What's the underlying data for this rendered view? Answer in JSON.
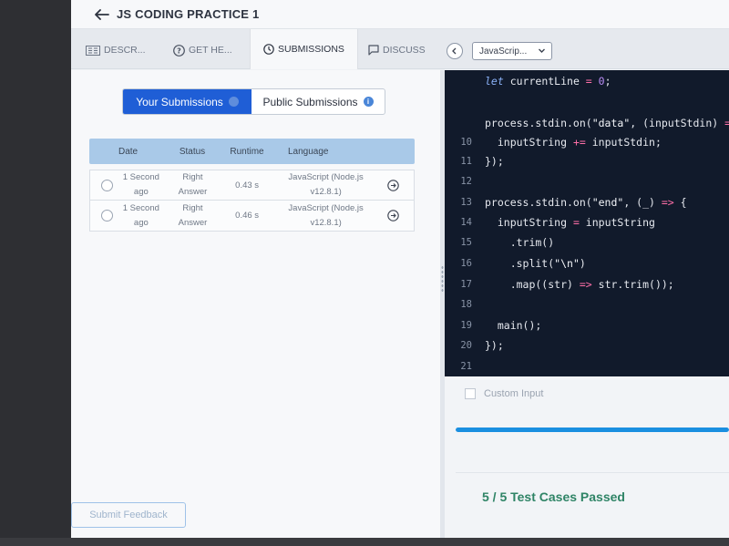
{
  "app": {
    "title": "JS CODING PRACTICE 1"
  },
  "tabs": [
    {
      "label": "DESCR...",
      "icon": "description-icon"
    },
    {
      "label": "GET HE...",
      "icon": "help-icon"
    },
    {
      "label": "SUBMISSIONS",
      "icon": "clock-icon",
      "active": true
    },
    {
      "label": "DISCUSS",
      "icon": "chat-icon"
    }
  ],
  "editor_toolbar": {
    "language": "JavaScrip..."
  },
  "submissions": {
    "toggle": {
      "yours": "Your Submissions",
      "public": "Public Submissions",
      "active": "yours"
    },
    "columns": [
      "Date",
      "Status",
      "Runtime",
      "Language"
    ],
    "rows": [
      {
        "date_1": "1 Second",
        "date_2": "ago",
        "status_1": "Right",
        "status_2": "Answer",
        "runtime": "0.43 s",
        "lang_1": "JavaScript (Node.js",
        "lang_2": "v12.8.1)"
      },
      {
        "date_1": "1 Second",
        "date_2": "ago",
        "status_1": "Right",
        "status_2": "Answer",
        "runtime": "0.46 s",
        "lang_1": "JavaScript (Node.js",
        "lang_2": "v12.8.1)"
      }
    ],
    "feedback_button": "Submit Feedback"
  },
  "editor": {
    "line_numbers": [
      "",
      "",
      "",
      "10",
      "11",
      "12",
      "13",
      "14",
      "15",
      "16",
      "17",
      "18",
      "19",
      "20",
      "21"
    ]
  },
  "console": {
    "custom_input_label": "Custom Input",
    "progress": 1.0,
    "result": "5 / 5 Test Cases Passed"
  },
  "colors": {
    "accent": "#1f5ed6",
    "table_header": "#a9c9e8",
    "editor_bg": "#111a2b",
    "success": "#2f8466",
    "progress": "#1a8fe0"
  }
}
